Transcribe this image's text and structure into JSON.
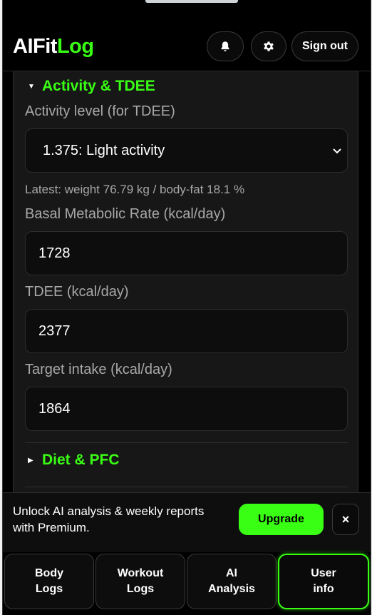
{
  "header": {
    "logo_part1": "AIFit",
    "logo_part2": "Log",
    "notifications_icon": "bell-icon",
    "settings_icon": "gear-icon",
    "sign_out_label": "Sign out"
  },
  "activity_section": {
    "title": "Activity & TDEE",
    "expanded": true,
    "activity_label": "Activity level (for TDEE)",
    "activity_value": "1.375: Light activity",
    "latest_text": "Latest: weight 76.79 kg / body-fat 18.1 %",
    "bmr_label": "Basal Metabolic Rate (kcal/day)",
    "bmr_value": "1728",
    "tdee_label": "TDEE (kcal/day)",
    "tdee_value": "2377",
    "target_label": "Target intake (kcal/day)",
    "target_value": "1864"
  },
  "diet_section": {
    "title": "Diet & PFC",
    "expanded": false
  },
  "banner": {
    "text": "Unlock AI analysis & weekly reports with Premium.",
    "upgrade_label": "Upgrade",
    "close_label": "×"
  },
  "nav": {
    "items": [
      {
        "label": "Body\nLogs",
        "active": false
      },
      {
        "label": "Workout\nLogs",
        "active": false
      },
      {
        "label": "AI\nAnalysis",
        "active": false
      },
      {
        "label": "User\ninfo",
        "active": true
      }
    ]
  },
  "colors": {
    "accent": "#39ff14",
    "background": "#000000",
    "panel": "#171717"
  }
}
